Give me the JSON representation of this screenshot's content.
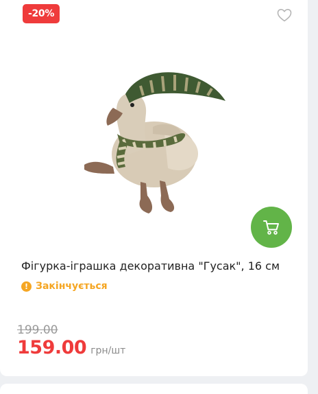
{
  "product": {
    "discount_badge": "-20%",
    "title": "Фігурка-іграшка декоративна \"Гусак\", 16 см",
    "stock_status": "Закінчується",
    "old_price": "199.00",
    "current_price": "159.00",
    "unit": "грн/шт"
  },
  "icons": {
    "favorite": "heart-outline-icon",
    "cart": "cart-icon",
    "stock": "exclamation-circle-icon"
  },
  "colors": {
    "discount": "#ef3b3b",
    "cart_button": "#62b448",
    "stock_warning": "#f5a623",
    "old_price": "#9a9a9a"
  }
}
